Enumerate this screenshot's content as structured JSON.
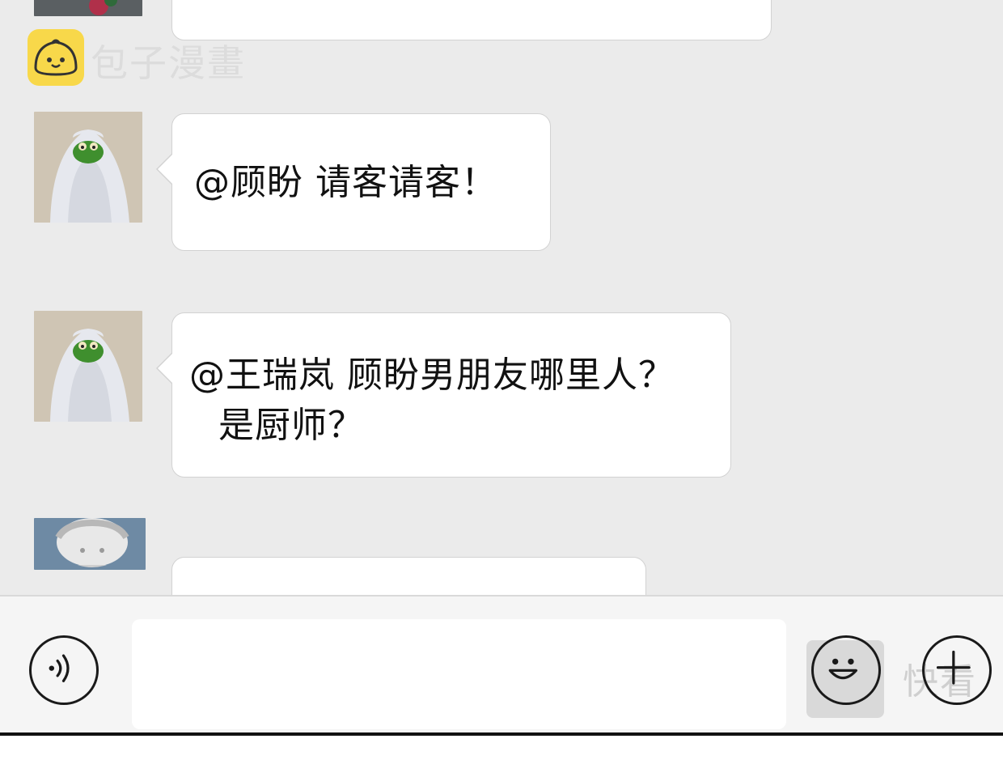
{
  "watermark": {
    "text": "包子漫畫"
  },
  "corner_watermark": {
    "text": "快看"
  },
  "messages": [
    {
      "text_lines": [
        "@顾盼 请客请客！"
      ],
      "avatar": "kermit-blanket-avatar"
    },
    {
      "text_lines": [
        "@王瑞岚 顾盼男朋友哪里人？",
        "是厨师？"
      ],
      "avatar": "kermit-blanket-avatar"
    },
    {
      "text_lines": [],
      "avatar": "statue-david-avatar"
    }
  ],
  "input_bar": {
    "voice_icon": "voice-icon",
    "emoji_icon": "smiley-icon",
    "add_icon": "plus-icon",
    "placeholder": ""
  },
  "colors": {
    "chat_background": "#ebebeb",
    "bubble": "#ffffff",
    "bubble_border": "#d2d2d2",
    "watermark_logo": "#f8d84a",
    "input_bar": "#f5f5f5"
  }
}
